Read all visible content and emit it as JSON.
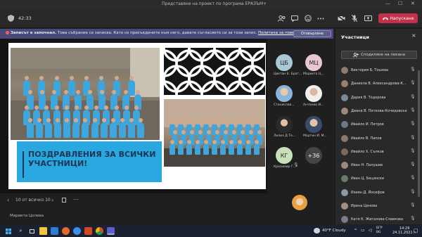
{
  "window": {
    "title": "Представяне на проект по програма ЕРАЗЪМ+",
    "min": "—",
    "max": "☐",
    "close": "✕"
  },
  "toolbar": {
    "timer": "42:33",
    "leave_label": "Напускане",
    "leave_icon": "phone-icon"
  },
  "banner": {
    "bold": "Записът е започнал.",
    "text": " Това събрание се записва. Като се присъедините към него, давате съгласието си за този запис.",
    "link": "Политика за поверителност",
    "dismiss": "Отхвърляне"
  },
  "slide": {
    "congrats": "ПОЗДРАВЛЕНИЯ ЗА ВСИЧКИ УЧАСТНИЦИ!",
    "counter": "10 от всичко 10",
    "presenter": "Мариета Цолева"
  },
  "gallery": {
    "tiles": [
      {
        "initials": "ЦБ",
        "name": "Цветан Б. Брат...",
        "color": "#a9c8d8"
      },
      {
        "initials": "МЦ",
        "name": "Мариета Ц...",
        "color": "#e8c8d0"
      },
      {
        "initials": "",
        "name": "Станислав...",
        "color": ""
      },
      {
        "initials": "",
        "name": "Антонио И...",
        "color": ""
      },
      {
        "initials": "",
        "name": "Лилия Д Те...",
        "color": ""
      },
      {
        "initials": "",
        "name": "Мартин И. М...",
        "color": ""
      },
      {
        "initials": "КГ",
        "name": "Красимир Г...",
        "color": "#c8e0b8"
      },
      {
        "initials": "+36",
        "name": "",
        "color": "#444444"
      }
    ]
  },
  "panel": {
    "title": "Участници",
    "share_label": "Споделяне на покана",
    "participants": [
      "Виктория Б. Тошева",
      "Даниела В. Александрова-К...",
      "Дария В. Тодорова",
      "Диана В. Петкова-Кочидовска",
      "Ивайло И. Петров",
      "Ивайло В. Папов",
      "Ивайло Х. Сълков",
      "Иван Н. Палушев",
      "Иван Ц. Бецински",
      "Изиян Д. Йосифов",
      "Ирена Ценова",
      "Катя К. Жигалова-Славкова"
    ]
  },
  "taskbar": {
    "weather": "40°F  Cloudy",
    "lang_top": "БГР",
    "lang_bottom": "BG",
    "time": "14:29",
    "date": "24.11.2021 г."
  }
}
